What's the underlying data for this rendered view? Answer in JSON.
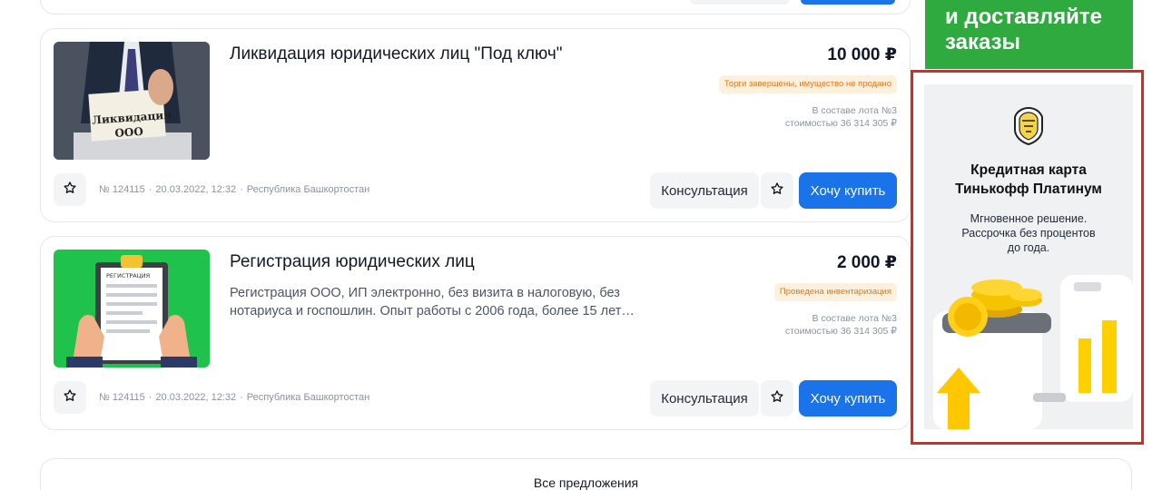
{
  "listings": [
    {
      "title": "Ликвидация юридических лиц \"Под ключ\"",
      "description": "",
      "price": "10 000 ₽",
      "badge": "Торги завершены, имущество не продано",
      "lot_line1": "В составе лота №3",
      "lot_line2": "стоимостью 36 314 305 ₽",
      "number": "№ 124115",
      "date": "20.03.2022, 12:32",
      "region": "Республика Башкортостан",
      "consult_label": "Консультация",
      "buy_label": "Хочу купить",
      "image_text_1": "Ликвидация",
      "image_text_2": "ООО"
    },
    {
      "title": "Регистрация юридических лиц",
      "description": "Регистрация ООО, ИП электронно, без визита в налоговую, без нотариуса и госпошлин. Опыт работы с 2006 года, более 15 лет…",
      "price": "2 000 ₽",
      "badge": "Проведена инвентаризация",
      "lot_line1": "В составе лота №3",
      "lot_line2": "стоимостью 36 314 305 ₽",
      "number": "№ 124115",
      "date": "20.03.2022, 12:32",
      "region": "Республика Башкортостан",
      "consult_label": "Консультация",
      "buy_label": "Хочу купить",
      "image_text_1": "РЕГИСТРАЦИЯ"
    }
  ],
  "all_offers_label": "Все предложения",
  "green_banner": {
    "line1": "и доставляйте",
    "line2": "заказы"
  },
  "ad": {
    "title_line1": "Кредитная карта",
    "title_line2": "Тинькофф Платинум",
    "sub_line1": "Мгновенное решение.",
    "sub_line2": "Рассрочка без процентов",
    "sub_line3": "до года."
  },
  "colors": {
    "accent": "#1a73e8",
    "badge_bg": "#fdf0dc",
    "badge_text": "#e07a1f",
    "green_banner": "#2eaa3f",
    "highlight_frame": "#e3261c"
  }
}
